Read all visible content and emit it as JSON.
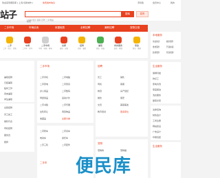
{
  "topbar": {
    "left": "欢迎来到便民库 [ 上海·切换城市 ]",
    "mid": "免费发布信息",
    "r1": "手机版",
    "r2": "会员中心",
    "r3": "我的"
  },
  "header": {
    "logo": "站子",
    "search_placeholder": "搜索",
    "search_button": "搜索",
    "post_button": "发布",
    "hot_words": "二手车  租房  兼职  招聘  二手物品"
  },
  "nav": [
    "二手市场",
    "车辆买卖",
    "房屋租售",
    "全职招聘",
    "兼职招聘",
    "宠物交易"
  ],
  "categories": [
    {
      "label": "二手",
      "sub": "二手 · 转让 · 回收",
      "color": "#f4b400"
    },
    {
      "label": "车辆",
      "sub": "二手车 · 新车",
      "color": "#e8411f"
    },
    {
      "label": "二手市场",
      "sub": "手机 · 电脑 · 家电",
      "color": "#d0d0d0"
    },
    {
      "label": "房屋",
      "sub": "出租 · 出售",
      "color": "#e8411f"
    },
    {
      "label": "招聘",
      "sub": "全职 · 兼职",
      "color": "#f4b400"
    },
    {
      "label": "兼职",
      "sub": "日结 · 周结",
      "color": "#4caf50"
    },
    {
      "label": "商务服务",
      "sub": "装修 · 家政",
      "color": "#e8411f"
    },
    {
      "label": "家政",
      "sub": "保洁 · 搬家",
      "color": "#f4b400"
    }
  ],
  "right_panel": {
    "title": "本地服务",
    "items": [
      "家政保洁",
      "搬家服务",
      "维修服务",
      "开锁换锁",
      "装修服务",
      "管道疏通"
    ]
  },
  "left_col": {
    "links": [
      "兼职招聘",
      "日结兼职",
      "临时工作",
      "周末兼职",
      "学生兼职",
      "广告模特兼职"
    ],
    "links2": [
      "全职招聘",
      "普工技工",
      "销售代表",
      "司机招聘",
      "服务员",
      "厨师"
    ]
  },
  "card_secondhand": {
    "title": "二手市场",
    "links": [
      "二手手机",
      "二手电脑",
      "二手家电",
      "二手家具",
      "办公用品",
      "二手数码",
      "母婴用品",
      "运动户外",
      "二手书籍",
      "二手乐器",
      "出售转让",
      "闲置物品",
      "收藏品",
      "全部分类"
    ]
  },
  "card_recruit": {
    "title": "招聘",
    "links": [
      "普工",
      "销售",
      "司机",
      "客服",
      "物流",
      "房产经纪",
      "餐饮",
      "保安",
      "文员",
      "美容美发",
      "教育培训",
      "更多职位"
    ]
  },
  "card_pets": {
    "title": "宠物",
    "links": [
      "宠物狗",
      "宠物猫",
      "宠物用品",
      "宠物服务"
    ]
  },
  "card_secondhand2": {
    "title": "二手车",
    "links": [
      "二手轿车",
      "二手货车",
      "电动车",
      "摩托车",
      "二手三轮",
      "二手配件"
    ]
  },
  "card_services": {
    "title": "生活服务",
    "links": [
      "家政保洁",
      "搬家服务",
      "家电维修",
      "开锁换锁",
      "管道疏通",
      "装修装饰",
      "婚庆摄影",
      "旅游服务"
    ]
  },
  "card_right2": {
    "title": "生活服务",
    "links": [
      "保姆月嫂",
      "钟点工",
      "家电清洗",
      "家庭保洁",
      "洗衣服务",
      "居家养老"
    ]
  },
  "card_right3": {
    "title": "商务服务",
    "links": [
      "法律咨询",
      "财务会计",
      "工商注册",
      "网站建设",
      "广告设计",
      "印刷包装"
    ]
  },
  "watermark": "便民库"
}
